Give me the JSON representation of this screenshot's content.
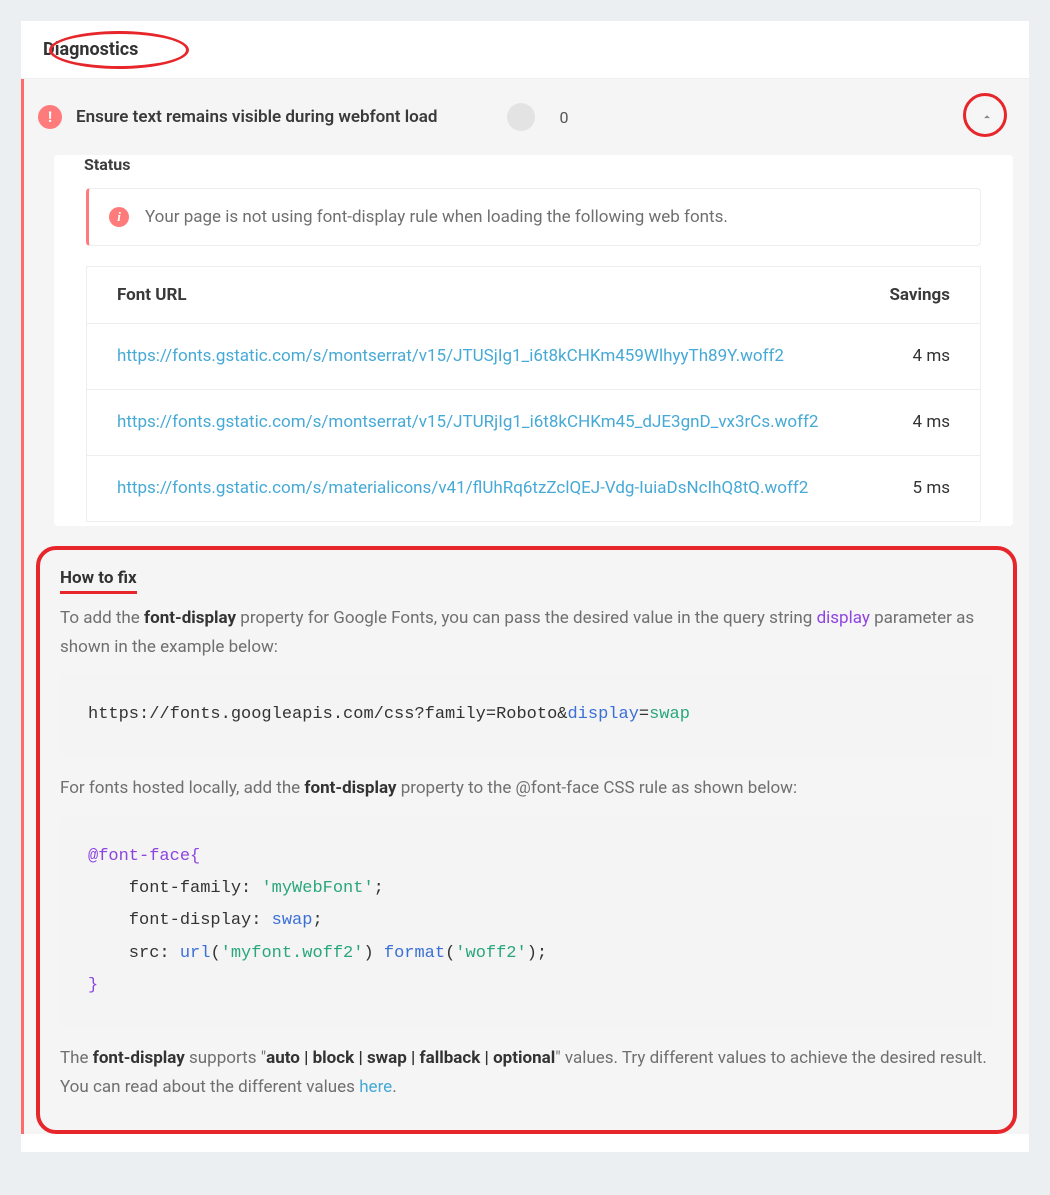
{
  "header": {
    "title": "Diagnostics"
  },
  "item": {
    "title": "Ensure text remains visible during webfont load",
    "score": "0"
  },
  "status": {
    "label": "Status",
    "message": "Your page is not using font-display rule when loading the following web fonts."
  },
  "table": {
    "col_url": "Font URL",
    "col_savings": "Savings",
    "rows": [
      {
        "url": "https://fonts.gstatic.com/s/montserrat/v15/JTUSjIg1_i6t8kCHKm459WlhyyTh89Y.woff2",
        "savings": "4 ms"
      },
      {
        "url": "https://fonts.gstatic.com/s/montserrat/v15/JTURjIg1_i6t8kCHKm45_dJE3gnD_vx3rCs.woff2",
        "savings": "4 ms"
      },
      {
        "url": "https://fonts.gstatic.com/s/materialicons/v41/flUhRq6tzZclQEJ-Vdg-IuiaDsNcIhQ8tQ.woff2",
        "savings": "5 ms"
      }
    ]
  },
  "howto": {
    "title": "How to fix",
    "p1_a": "To add the ",
    "p1_kw1": "font-display",
    "p1_b": " property for Google Fonts, you can pass the desired value in the query string ",
    "p1_disp": "display",
    "p1_c": " parameter as shown in the example below:",
    "code1_raw": "https://fonts.googleapis.com/css?family=Roboto&",
    "code1_disp": "display",
    "code1_eq": "=",
    "code1_swap": "swap",
    "p2_a": "For fonts hosted locally, add the ",
    "p2_kw": "font-display",
    "p2_b": " property to the @font-face CSS rule as shown below:",
    "code2": {
      "l1": "@font-face{",
      "l2a": "    font-family: ",
      "l2b": "'myWebFont'",
      "l2c": ";",
      "l3a": "    font-display: ",
      "l3b": "swap",
      "l3c": ";",
      "l4a": "    src: ",
      "l4b": "url",
      "l4c": "(",
      "l4d": "'myfont.woff2'",
      "l4e": ") ",
      "l4f": "format",
      "l4g": "(",
      "l4h": "'woff2'",
      "l4i": ");",
      "l5": "}"
    },
    "p3_a": "The ",
    "p3_kw1": "font-display",
    "p3_b": " supports \"",
    "p3_kw2": "auto | block | swap | fallback | optional",
    "p3_c": "\" values. Try different values to achieve the desired result. You can read about the different values ",
    "p3_here": "here",
    "p3_d": "."
  }
}
